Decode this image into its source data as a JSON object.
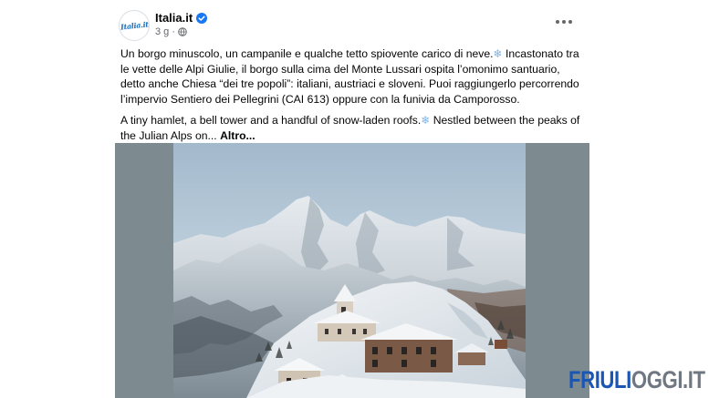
{
  "post": {
    "author": "Italia.it",
    "avatar_text": "Italia.it",
    "timestamp": "3 g",
    "paragraph_it": [
      "Un borgo minuscolo, un campanile e qualche tetto spiovente carico di neve.",
      " Incastonato tra le vette delle Alpi Giulie, il borgo sulla cima del Monte Lussari ospita l’omonimo santuario, detto anche Chiesa “dei tre popoli”: italiani, austriaci e sloveni. Puoi raggiungerlo percorrendo l’impervio Sentiero dei Pellegrini (CAI 613) oppure con la funivia da Camporosso."
    ],
    "paragraph_en": [
      "A tiny hamlet, a bell tower and a handful of snow-laden roofs.",
      " Nestled between the peaks of the Julian Alps on... "
    ],
    "see_more": "Altro...",
    "snowflake": "❄",
    "photo_alt": "Borgo del Monte Lussari innevato tra le Alpi Giulie"
  },
  "watermark": {
    "part1": "FRIULI",
    "part2": "OGGI.IT"
  },
  "colors": {
    "verified": "#1877f2",
    "watermark_blue": "#1a56b4",
    "watermark_gray": "#6e7782"
  },
  "icons": {
    "verified": "verified-badge-icon",
    "globe": "globe-icon",
    "more": "more-options-icon",
    "snow": "snowflake-icon"
  }
}
